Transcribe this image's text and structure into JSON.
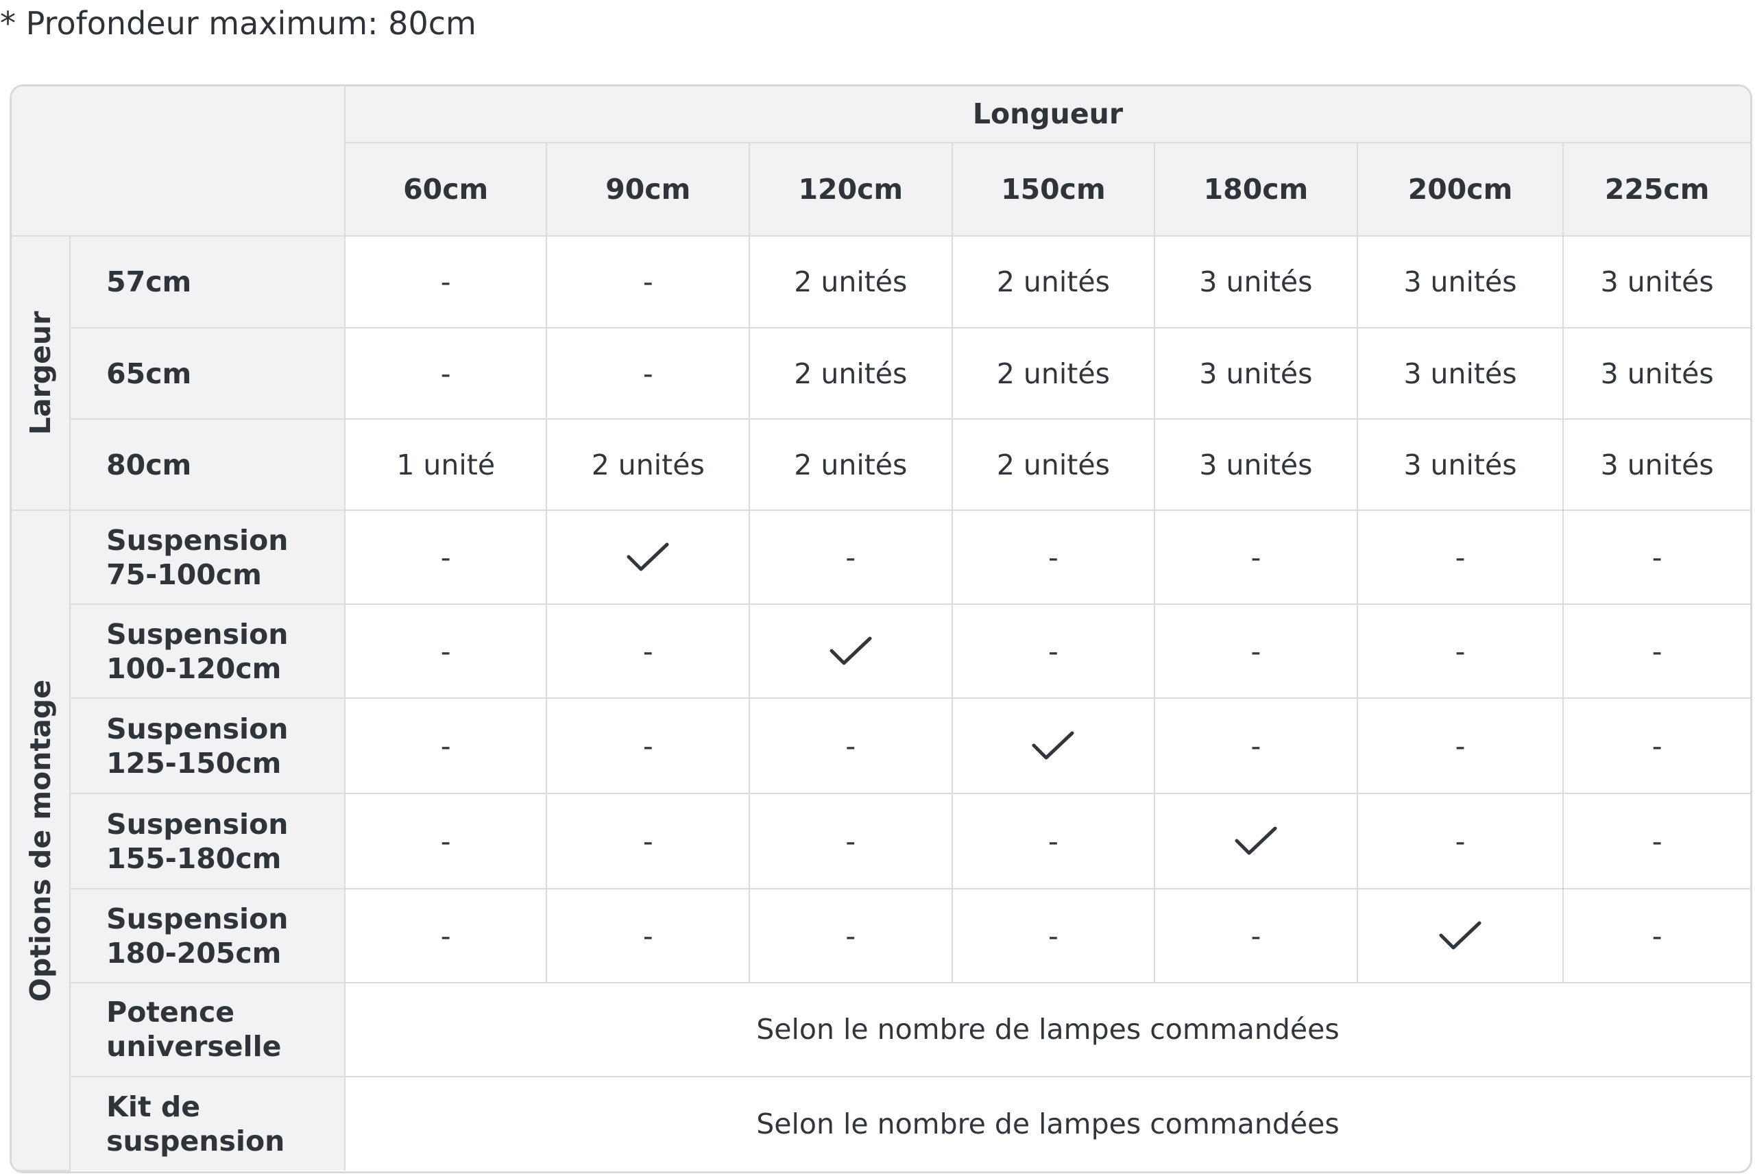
{
  "note": "* Profondeur maximum: 80cm",
  "header": {
    "length_label": "Longueur",
    "columns": [
      "60cm",
      "90cm",
      "120cm",
      "150cm",
      "180cm",
      "200cm",
      "225cm"
    ]
  },
  "width_group": {
    "label": "Largeur",
    "rows": [
      {
        "label": "57cm",
        "cells": [
          "-",
          "-",
          "2 unités",
          "2 unités",
          "3 unités",
          "3 unités",
          "3 unités"
        ]
      },
      {
        "label": "65cm",
        "cells": [
          "-",
          "-",
          "2 unités",
          "2 unités",
          "3 unités",
          "3 unités",
          "3 unités"
        ]
      },
      {
        "label": "80cm",
        "cells": [
          "1 unité",
          "2 unités",
          "2 unités",
          "2 unités",
          "3 unités",
          "3 unités",
          "3 unités"
        ]
      }
    ]
  },
  "mount_group": {
    "label": "Options de montage",
    "suspension_rows": [
      {
        "label_line1": "Suspension",
        "label_line2": "75-100cm",
        "checked_index": 1
      },
      {
        "label_line1": "Suspension",
        "label_line2": "100-120cm",
        "checked_index": 2
      },
      {
        "label_line1": "Suspension",
        "label_line2": "125-150cm",
        "checked_index": 3
      },
      {
        "label_line1": "Suspension",
        "label_line2": "155-180cm",
        "checked_index": 4
      },
      {
        "label_line1": "Suspension",
        "label_line2": "180-205cm",
        "checked_index": 5
      }
    ],
    "dash": "-",
    "check_icon": "checkmark-icon",
    "span_rows": [
      {
        "label_line1": "Potence",
        "label_line2": "universelle",
        "text": "Selon le nombre de lampes commandées"
      },
      {
        "label_line1": "Kit de",
        "label_line2": "suspension",
        "text": "Selon le nombre de lampes commandées"
      }
    ]
  }
}
